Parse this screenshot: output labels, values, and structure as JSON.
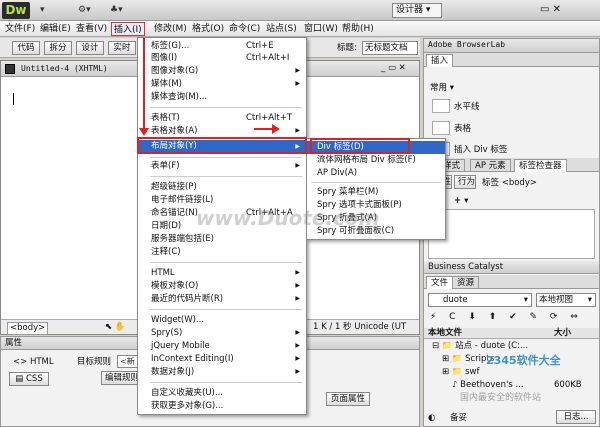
{
  "app": {
    "logo": "Dw",
    "mode": "设计器",
    "tb_icon1": "▾",
    "tb_icon2": "⚙▾",
    "tb_icon3": "♣▾"
  },
  "menubar": [
    "文件(F)",
    "编辑(E)",
    "查看(V)",
    "插入(I)",
    "修改(M)",
    "格式(O)",
    "命令(C)",
    "站点(S)",
    "窗口(W)",
    "帮助(H)"
  ],
  "doc_toolbar": {
    "code": "代码",
    "split": "拆分",
    "design": "设计",
    "live": "实时",
    "title_label": "标题:",
    "title_value": "无标题文档"
  },
  "document": {
    "tab": "Untitled-4 (XHTML)",
    "tag": "<body>",
    "status": "1 K / 1 秒 Unicode (UT"
  },
  "properties": {
    "header": "属性",
    "html": "HTML",
    "css": "CSS",
    "target_rule_label": "目标规则",
    "target_rule_value": "<新",
    "edit_rule": "编辑规则",
    "page_props": "页面属性"
  },
  "insert_menu": [
    {
      "label": "标签(G)...",
      "shortcut": "Ctrl+E"
    },
    {
      "label": "图像(I)",
      "shortcut": "Ctrl+Alt+I"
    },
    {
      "label": "图像对象(G)",
      "arrow": "▶"
    },
    {
      "label": "媒体(M)",
      "arrow": "▶"
    },
    {
      "label": "媒体查询(M)..."
    },
    {
      "label": "表格(T)",
      "shortcut": "Ctrl+Alt+T"
    },
    {
      "label": "表格对象(A)",
      "arrow": "▶"
    },
    {
      "label": "布局对象(Y)",
      "arrow": "▶"
    },
    {
      "label": "表单(F)",
      "arrow": "▶"
    },
    {
      "label": "超级链接(P)"
    },
    {
      "label": "电子邮件链接(L)"
    },
    {
      "label": "命名锚记(N)",
      "shortcut": "Ctrl+Alt+A"
    },
    {
      "label": "日期(D)"
    },
    {
      "label": "服务器端包括(E)"
    },
    {
      "label": "注释(C)"
    },
    {
      "label": "HTML",
      "arrow": "▶"
    },
    {
      "label": "模板对象(O)",
      "arrow": "▶"
    },
    {
      "label": "最近的代码片断(R)",
      "arrow": "▶"
    },
    {
      "label": "Widget(W)..."
    },
    {
      "label": "Spry(S)",
      "arrow": "▶"
    },
    {
      "label": "jQuery Mobile",
      "arrow": "▶"
    },
    {
      "label": "InContext Editing(I)",
      "arrow": "▶"
    },
    {
      "label": "数据对象(J)",
      "arrow": "▶"
    },
    {
      "label": "自定义收藏夹(U)..."
    },
    {
      "label": "获取更多对象(G)..."
    }
  ],
  "layout_submenu": [
    "Div 标签(D)",
    "流体网格布局 Div 标签(F)",
    "AP Div(A)",
    "Spry 菜单栏(M)",
    "Spry 选项卡式面板(P)",
    "Spry 折叠式(A)",
    "Spry 可折叠面板(C)"
  ],
  "right_panel": {
    "browserlab": "Adobe BrowserLab",
    "insert_tab": "插入",
    "category": "常用",
    "items": [
      "水平线",
      "表格",
      "插入 Div 标签"
    ],
    "css_tabs": [
      "样式",
      "AP 元素",
      "标签检查器"
    ],
    "attr_btns": [
      "属性",
      "行为"
    ],
    "tag_label": "标签 <body>",
    "bc_header": "Business Catalyst",
    "files_tabs": [
      "文件",
      "资源"
    ],
    "site_select": "duote",
    "view_select": "本地视图",
    "col_local": "本地文件",
    "col_size": "大小",
    "tree": [
      "站点 - duote (C:...",
      "Scripts",
      "swf",
      "Beethoven's ..."
    ],
    "file_size": "600KB",
    "status_left": "备妥",
    "log_button": "日志..."
  },
  "watermark": "www.Duote.com",
  "corner_brand": "2345软件大全",
  "corner_slogan": "国内最安全的软件站"
}
